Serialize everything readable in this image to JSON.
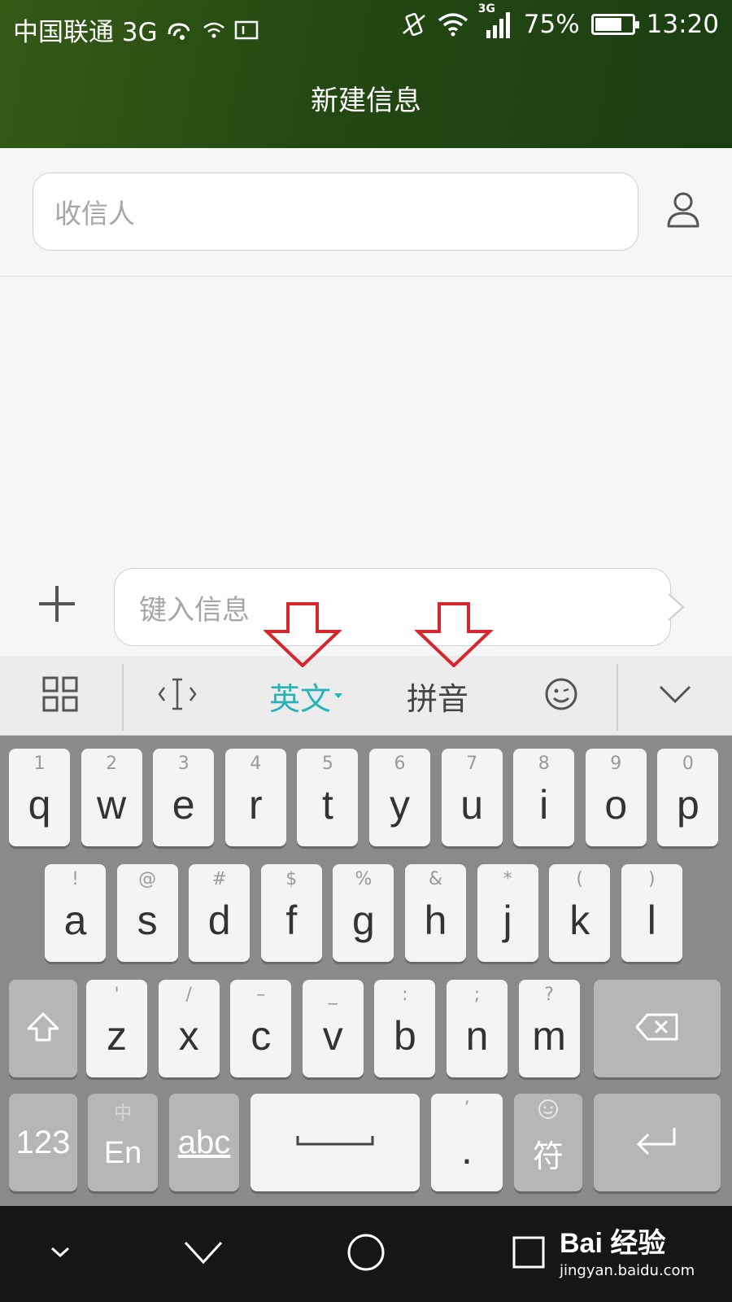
{
  "status_bar": {
    "carrier": "中国联通 3G",
    "network_small": "3G",
    "battery": "75%",
    "battery_level": 0.75,
    "time": "13:20"
  },
  "header": {
    "title": "新建信息"
  },
  "recipient": {
    "placeholder": "收信人"
  },
  "compose": {
    "placeholder": "键入信息"
  },
  "ime_toolbar": {
    "mode_english": "英文",
    "mode_pinyin": "拼音"
  },
  "keyboard": {
    "row1": [
      {
        "main": "q",
        "sub": "1"
      },
      {
        "main": "w",
        "sub": "2"
      },
      {
        "main": "e",
        "sub": "3"
      },
      {
        "main": "r",
        "sub": "4"
      },
      {
        "main": "t",
        "sub": "5"
      },
      {
        "main": "y",
        "sub": "6"
      },
      {
        "main": "u",
        "sub": "7"
      },
      {
        "main": "i",
        "sub": "8"
      },
      {
        "main": "o",
        "sub": "9"
      },
      {
        "main": "p",
        "sub": "0"
      }
    ],
    "row2": [
      {
        "main": "a",
        "sub": "!"
      },
      {
        "main": "s",
        "sub": "@"
      },
      {
        "main": "d",
        "sub": "#"
      },
      {
        "main": "f",
        "sub": "$"
      },
      {
        "main": "g",
        "sub": "%"
      },
      {
        "main": "h",
        "sub": "&"
      },
      {
        "main": "j",
        "sub": "*"
      },
      {
        "main": "k",
        "sub": "("
      },
      {
        "main": "l",
        "sub": ")"
      }
    ],
    "row3": [
      {
        "main": "z",
        "sub": "'"
      },
      {
        "main": "x",
        "sub": "/"
      },
      {
        "main": "c",
        "sub": "–"
      },
      {
        "main": "v",
        "sub": "_"
      },
      {
        "main": "b",
        "sub": ":"
      },
      {
        "main": "n",
        "sub": ";"
      },
      {
        "main": "m",
        "sub": "?"
      }
    ],
    "numbers_label": "123",
    "lang_switch_sub": "中",
    "lang_switch_label": "En",
    "abc_label": "abc",
    "punct_sub": "’",
    "punct_main": ".",
    "symbol_label": "符"
  },
  "watermark": {
    "brand": "Bai 经验",
    "domain": "jingyan.baidu.com"
  },
  "colors": {
    "header": "#244812",
    "accent": "#27b4b8",
    "annotation": "#d8262d"
  }
}
